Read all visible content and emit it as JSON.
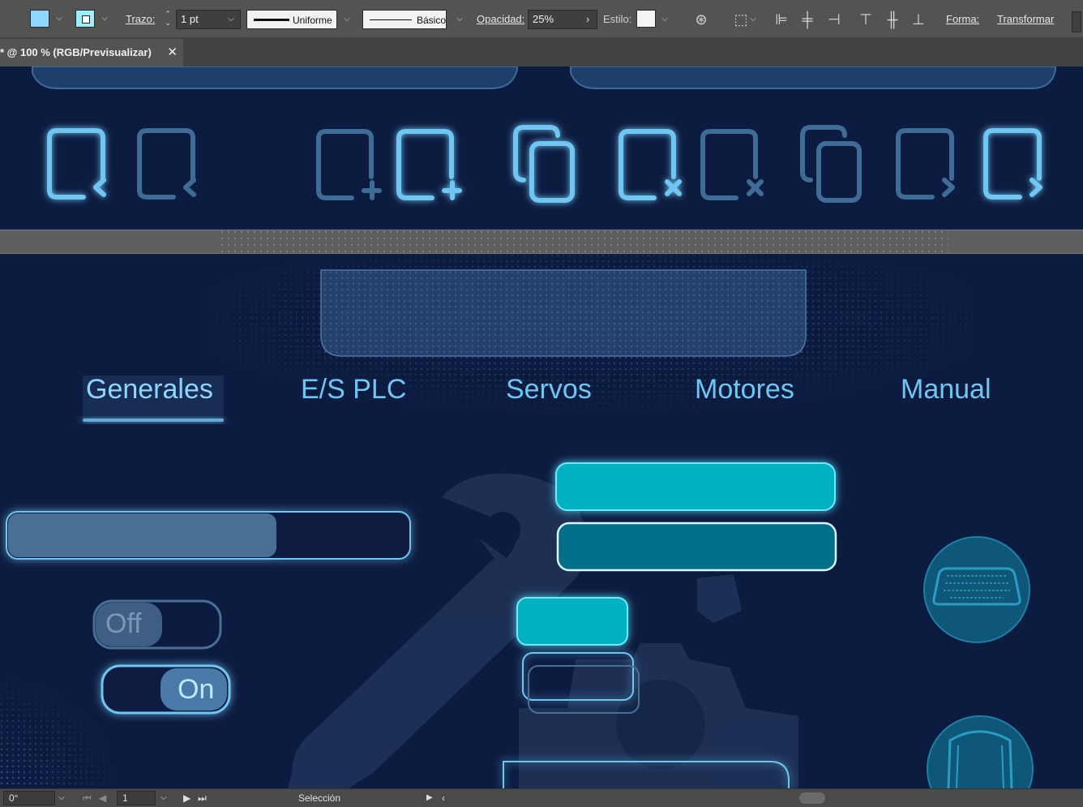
{
  "control_bar": {
    "fill_color": "#8fd8ff",
    "stroke_color": "#9af0ff",
    "stroke_label": "Trazo:",
    "stroke_weight": "1 pt",
    "variable_width_profile": "Uniforme",
    "brush_definition": "Básico",
    "opacity_label": "Opacidad:",
    "opacity_value": "25%",
    "style_label": "Estilo:",
    "shape_label": "Forma:",
    "transform_label": "Transformar"
  },
  "document_tab": {
    "title": "* @ 100 % (RGB/Previsualizar)",
    "close": "✕"
  },
  "artboard": {
    "tabs": [
      {
        "label": "Generales",
        "active": true
      },
      {
        "label": "E/S PLC",
        "active": false
      },
      {
        "label": "Servos",
        "active": false
      },
      {
        "label": "Motores",
        "active": false
      },
      {
        "label": "Manual",
        "active": false
      }
    ],
    "progress_level": 0.67,
    "toggle_off_label": "Off",
    "toggle_on_label": "On",
    "colors": {
      "background": "#0c1c40",
      "accent": "#6fc6f2",
      "teal": "#00b1c1",
      "teal_dark": "#007089",
      "muted_blue": "#4a6f94"
    }
  },
  "status_bar": {
    "rotation": "0°",
    "artboard_number": "1",
    "tool_name": "Selección"
  }
}
